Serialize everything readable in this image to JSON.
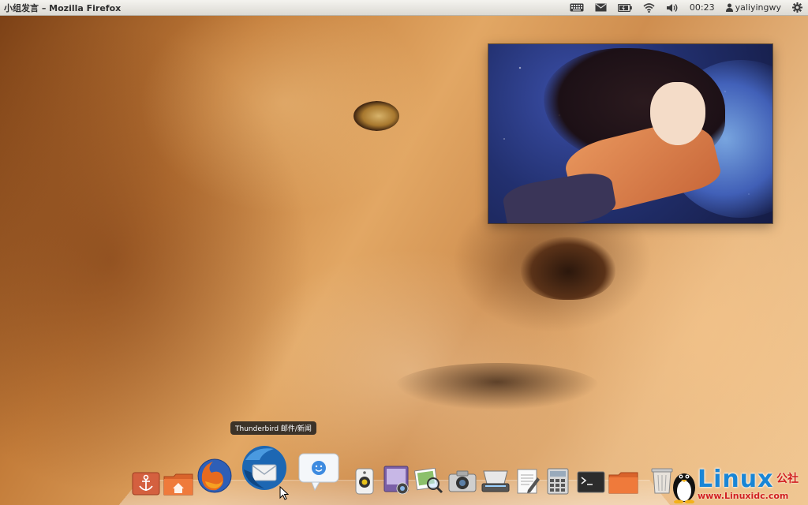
{
  "panel": {
    "window_title": "小组发言 – Mozilla Firefox",
    "clock": "00:23",
    "username": "yaliyingwy"
  },
  "dock": {
    "tooltip": "Thunderbird 邮件/新闻",
    "items": [
      {
        "name": "anchor-icon"
      },
      {
        "name": "home-folder-icon"
      },
      {
        "name": "firefox-icon"
      },
      {
        "name": "thunderbird-icon"
      },
      {
        "name": "chat-bubble-icon"
      },
      {
        "name": "speaker-icon"
      },
      {
        "name": "photo-viewer-icon"
      },
      {
        "name": "image-magnifier-icon"
      },
      {
        "name": "camera-icon"
      },
      {
        "name": "scanner-icon"
      },
      {
        "name": "text-editor-icon"
      },
      {
        "name": "calculator-icon"
      },
      {
        "name": "terminal-icon"
      },
      {
        "name": "folder-icon"
      },
      {
        "name": "trash-icon"
      }
    ]
  },
  "watermark": {
    "brand": "Linux",
    "suffix": "公社",
    "url": "www.Linuxidc.com"
  },
  "colors": {
    "panel_bg": "#e8e6e0",
    "watermark_blue": "#1a86d6",
    "watermark_red": "#d12020"
  }
}
